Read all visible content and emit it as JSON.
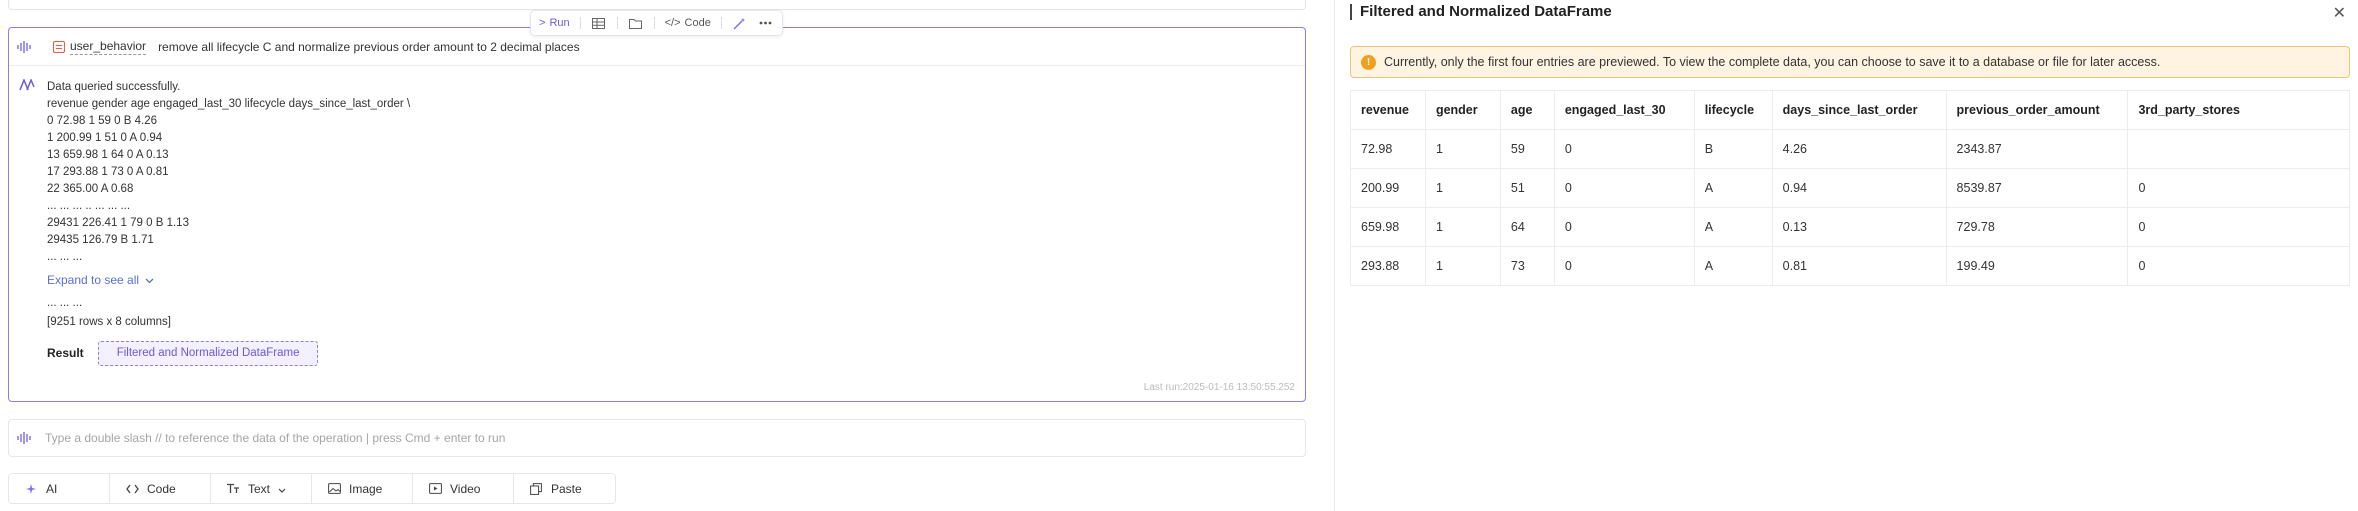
{
  "toolbar": {
    "run_label": "Run",
    "code_label": "Code"
  },
  "cell": {
    "datasource": "user_behavior",
    "prompt": "remove all lifecycle C and normalize previous order amount to 2 decimal places",
    "output_lines": [
      "Data queried successfully.",
      "revenue gender age engaged_last_30 lifecycle days_since_last_order \\",
      "0 72.98 1 59 0 B 4.26",
      "1 200.99 1 51 0 A 0.94",
      "13 659.98 1 64 0 A 0.13",
      "17 293.88 1 73 0 A 0.81",
      "22 365.00 A 0.68",
      "... ... ... .. ... ... ...",
      "29431 226.41 1 79 0 B 1.13",
      "29435 126.79 B 1.71",
      "... ... ..."
    ],
    "expand_label": "Expand to see all",
    "ellipsis_after": "... ... ...",
    "rows_info": "[9251 rows x 8 columns]",
    "result_label": "Result",
    "result_chip": "Filtered and Normalized DataFrame",
    "last_run": "Last run:2025-01-16 13:50:55.252"
  },
  "input": {
    "placeholder": "Type a double slash // to reference the data of the operation | press Cmd + enter to run"
  },
  "add_bar": [
    {
      "label": "AI",
      "icon": "sparkle-icon"
    },
    {
      "label": "Code",
      "icon": "code-icon"
    },
    {
      "label": "Text",
      "icon": "text-icon"
    },
    {
      "label": "Image",
      "icon": "image-icon"
    },
    {
      "label": "Video",
      "icon": "video-icon"
    },
    {
      "label": "Paste",
      "icon": "paste-icon"
    }
  ],
  "panel": {
    "title": "Filtered and Normalized DataFrame",
    "notice": "Currently, only the first four entries are previewed. To view the complete data, you can choose to save it to a database or file for later access.",
    "columns": [
      "revenue",
      "gender",
      "age",
      "engaged_last_30",
      "lifecycle",
      "days_since_last_order",
      "previous_order_amount",
      "3rd_party_stores"
    ],
    "rows": [
      [
        "72.98",
        "1",
        "59",
        "0",
        "B",
        "4.26",
        "2343.87",
        ""
      ],
      [
        "200.99",
        "1",
        "51",
        "0",
        "A",
        "0.94",
        "8539.87",
        "0"
      ],
      [
        "659.98",
        "1",
        "64",
        "0",
        "A",
        "0.13",
        "729.78",
        "0"
      ],
      [
        "293.88",
        "1",
        "73",
        "0",
        "A",
        "0.81",
        "199.49",
        "0"
      ]
    ]
  },
  "colors": {
    "accent": "#8b7cf0",
    "link": "#5a6fd6",
    "warning_bg": "#fff4e1",
    "warning_icon": "#f0a020"
  }
}
